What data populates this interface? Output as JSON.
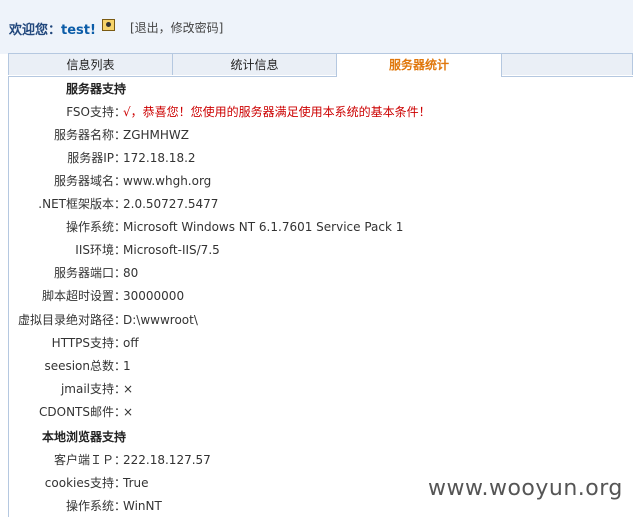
{
  "header": {
    "welcome_prefix": "欢迎您：",
    "username": "test!",
    "links": "[退出，修改密码]"
  },
  "tabs": [
    "信息列表",
    "统计信息",
    "服务器统计",
    ""
  ],
  "server_section": {
    "title": "服务器支持",
    "rows": [
      {
        "label": "FSO支持：",
        "value": "√，恭喜您！您使用的服务器满足使用本系统的基本条件！"
      },
      {
        "label": "服务器名称：",
        "value": "ZGHMHWZ"
      },
      {
        "label": "服务器IP：",
        "value": "172.18.18.2"
      },
      {
        "label": "服务器域名：",
        "value": "www.whgh.org"
      },
      {
        "label": ".NET框架版本：",
        "value": "2.0.50727.5477"
      },
      {
        "label": "操作系统：",
        "value": "Microsoft Windows NT 6.1.7601 Service Pack 1"
      },
      {
        "label": "IIS环境：",
        "value": "Microsoft-IIS/7.5"
      },
      {
        "label": "服务器端口：",
        "value": "80"
      },
      {
        "label": "脚本超时设置：",
        "value": "30000000"
      },
      {
        "label": "虚拟目录绝对路径：",
        "value": "D:\\wwwroot\\"
      },
      {
        "label": "HTTPS支持：",
        "value": "off"
      },
      {
        "label": "seesion总数：",
        "value": "1"
      },
      {
        "label": "jmail支持：",
        "value": "×"
      },
      {
        "label": "CDONTS邮件：",
        "value": "×"
      }
    ]
  },
  "client_section": {
    "title": "本地浏览器支持",
    "rows": [
      {
        "label": "客户端ＩＰ：",
        "value": "222.18.127.57"
      },
      {
        "label": "cookies支持：",
        "value": "True"
      },
      {
        "label": "操作系统：",
        "value": "WinNT"
      }
    ]
  },
  "watermark": "www.wooyun.org"
}
